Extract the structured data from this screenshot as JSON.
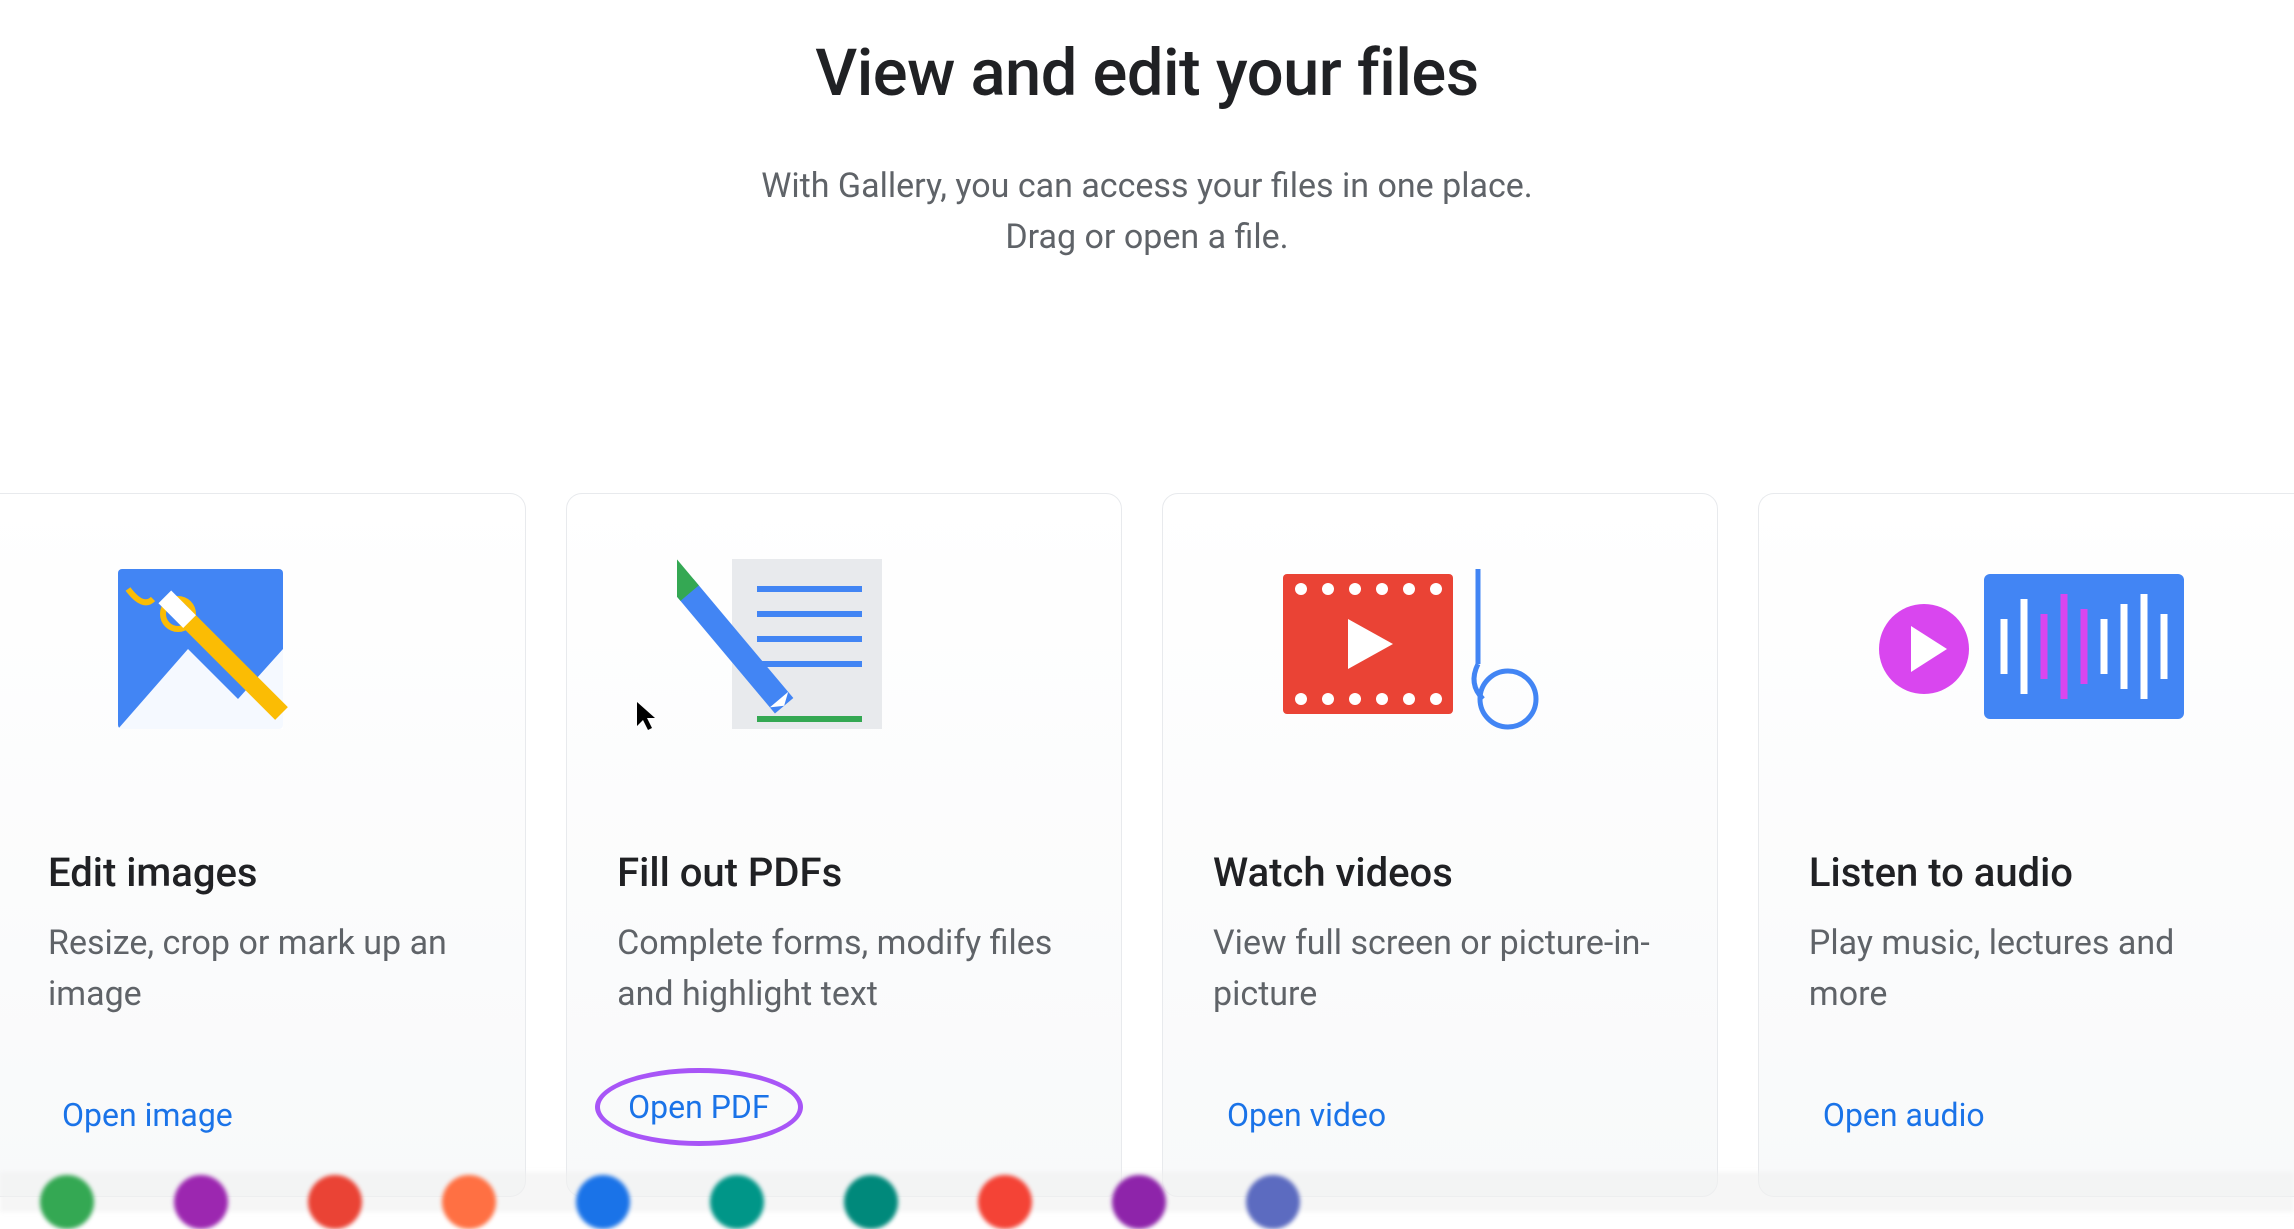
{
  "header": {
    "title": "View and edit your files",
    "subtitle_line1": "With Gallery, you can access your files in one place.",
    "subtitle_line2": "Drag or open a file."
  },
  "cards": [
    {
      "title": "Edit images",
      "description": "Resize, crop or mark up an image",
      "action": "Open image",
      "icon": "image-edit-icon"
    },
    {
      "title": "Fill out PDFs",
      "description": "Complete forms, modify files and highlight text",
      "action": "Open PDF",
      "icon": "pdf-edit-icon",
      "highlighted": true
    },
    {
      "title": "Watch videos",
      "description": "View full screen or picture-in-picture",
      "action": "Open video",
      "icon": "video-play-icon"
    },
    {
      "title": "Listen to audio",
      "description": "Play music, lectures and more",
      "action": "Open audio",
      "icon": "audio-waveform-icon"
    }
  ]
}
